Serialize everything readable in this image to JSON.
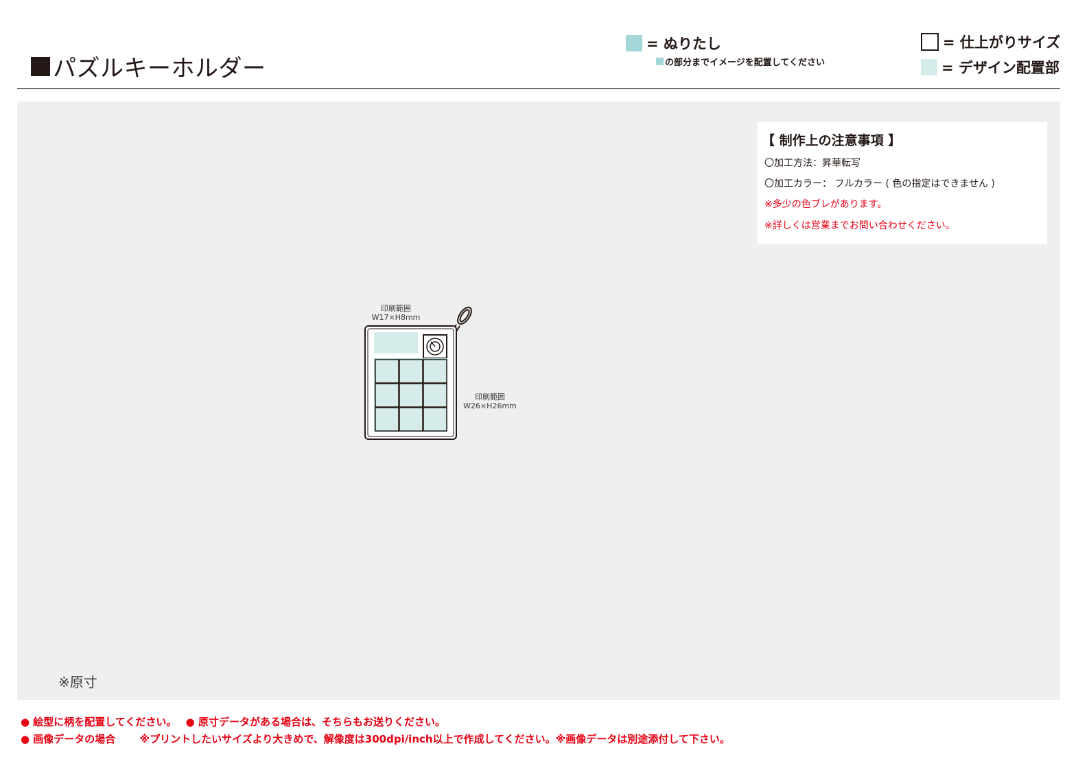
{
  "header": {
    "title": "パズルキーホルダー"
  },
  "legend": {
    "bleed_label": "= ぬりたし",
    "bleed_note": "の部分までイメージを配置してください",
    "finish_label": "= 仕上がりサイズ",
    "design_label": "= デザイン配置部",
    "colors": {
      "bleed": "#a4d8d8",
      "design": "#d6ecea",
      "finish_border": "#231815"
    }
  },
  "notes": {
    "title": "【 制作上の注意事項 】",
    "lines": [
      "〇加工方法：昇華転写",
      "〇加工カラー： フルカラー ( 色の指定はできません )",
      "※多少の色ブレがあります。",
      "※詳しくは営業までお問い合わせください。"
    ]
  },
  "diagram": {
    "label_top_1": "印刷範囲",
    "label_top_2": "W17×H8mm",
    "label_right_1": "印刷範囲",
    "label_right_2": "W26×H26mm"
  },
  "canvas_note": "※原寸",
  "footer": {
    "line1_a": "● 絵型に柄を配置してください。",
    "line1_b": "● 原寸データがある場合は、そちらもお送りください。",
    "line2_a": "● 画像データの場合",
    "line2_b": "※プリントしたいサイズより大きめで、解像度は300dpi/inch以上で作成してください。※画像データは別途添付して下さい。"
  },
  "colors": {
    "accent_red": "#e60012",
    "canvas_bg": "#eeefee"
  }
}
